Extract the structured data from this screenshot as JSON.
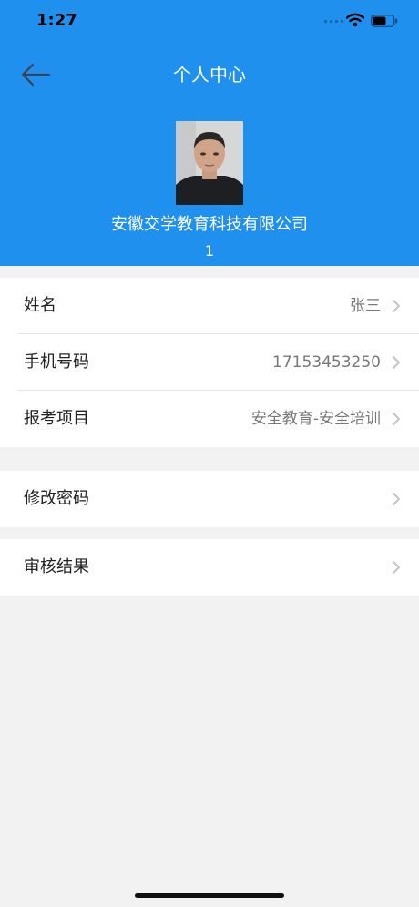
{
  "status_bar": {
    "time": "1:27"
  },
  "nav": {
    "title": "个人中心"
  },
  "profile": {
    "company": "安徽交学教育科技有限公司",
    "number": "1"
  },
  "info_rows": [
    {
      "label": "姓名",
      "value": "张三"
    },
    {
      "label": "手机号码",
      "value": "17153453250"
    },
    {
      "label": "报考项目",
      "value": "安全教育-安全培训"
    }
  ],
  "settings": {
    "change_password": "修改密码"
  },
  "audit": {
    "result": "审核结果"
  },
  "colors": {
    "header": "#2090ee",
    "page_bg": "#f2f2f2"
  }
}
